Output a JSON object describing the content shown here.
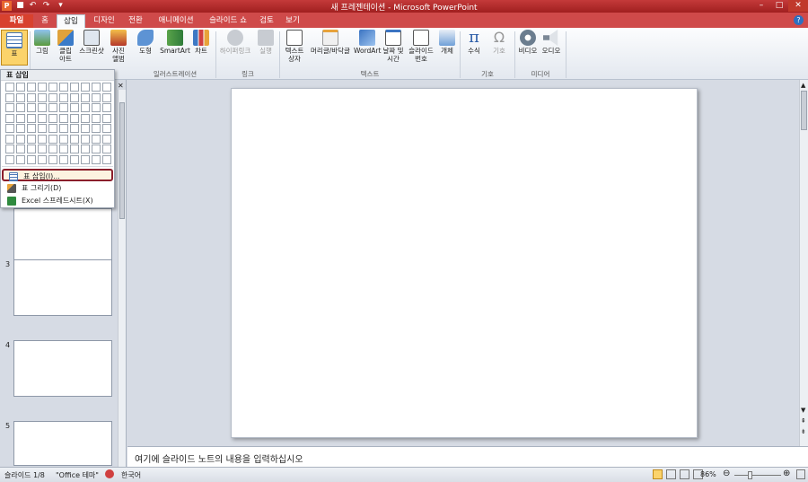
{
  "window": {
    "title": "새 프레젠테이션 - Microsoft PowerPoint"
  },
  "quick_access": [
    {
      "icon": "powerpoint-logo-icon",
      "glyph": "P"
    },
    {
      "icon": "save-icon",
      "glyph": "■"
    },
    {
      "icon": "undo-icon",
      "glyph": "↶"
    },
    {
      "icon": "redo-icon",
      "glyph": "↷"
    },
    {
      "icon": "customize-icon",
      "glyph": "▾"
    }
  ],
  "window_controls": {
    "minimize": "–",
    "maximize": "□",
    "close": "✕"
  },
  "tabs": [
    "파일",
    "홈",
    "삽입",
    "디자인",
    "전환",
    "애니메이션",
    "슬라이드 쇼",
    "검토",
    "보기"
  ],
  "active_tab": "삽입",
  "ribbon": {
    "groups": {
      "illustrations": "일러스트레이션",
      "links": "링크",
      "text": "텍스트",
      "symbols": "기호",
      "media": "미디어"
    },
    "buttons": {
      "table": "표",
      "picture": "그림",
      "clipart": "클립\n아트",
      "screenshot": "스크린샷",
      "photo_album": "사진\n앨범",
      "shapes": "도형",
      "smartart": "SmartArt",
      "chart": "차트",
      "hyperlink": "하이퍼링크",
      "action": "실행",
      "textbox": "텍스트\n상자",
      "header_footer": "머리글/바닥글",
      "wordart": "WordArt",
      "date_time": "날짜 및\n시간",
      "slide_number": "슬라이드\n번호",
      "object": "개체",
      "equation": "수식",
      "symbol": "기호",
      "video": "비디오",
      "audio": "오디오"
    }
  },
  "table_dropdown": {
    "header": "표 삽입",
    "grid_cols": 10,
    "grid_rows": 8,
    "items": [
      "표 삽입(I)...",
      "표 그리기(D)",
      "Excel 스프레드시트(X)"
    ]
  },
  "slide_numbers": [
    "3",
    "4",
    "5"
  ],
  "notes_placeholder": "여기에 슬라이드 노트의 내용을 입력하십시오",
  "status": {
    "slide": "슬라이드 1/8",
    "theme": "\"Office 테마\"",
    "language": "한국어",
    "zoom": "86%"
  },
  "colors": {
    "title_red": "#b02a2a",
    "file_tab": "#d8412e",
    "highlight": "#8b1e2b"
  }
}
